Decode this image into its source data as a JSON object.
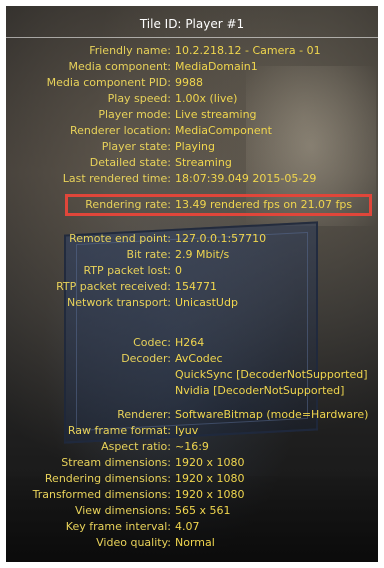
{
  "tile": {
    "title_prefix": "Tile ID:",
    "title_value": "Player #1"
  },
  "section1": [
    {
      "label": "Friendly name:",
      "value": "10.2.218.12 - Camera - 01"
    },
    {
      "label": "Media component:",
      "value": "MediaDomain1"
    },
    {
      "label": "Media component PID:",
      "value": "9988"
    },
    {
      "label": "Play speed:",
      "value": "1.00x (live)"
    },
    {
      "label": "Player mode:",
      "value": "Live streaming"
    },
    {
      "label": "Renderer location:",
      "value": "MediaComponent"
    },
    {
      "label": "Player state:",
      "value": "Playing"
    },
    {
      "label": "Detailed state:",
      "value": "Streaming"
    },
    {
      "label": "Last rendered time:",
      "value": "18:07:39.049 2015-05-29"
    },
    {
      "label": "Rendering rate:",
      "value": "13.49 rendered fps on 21.07 fps"
    }
  ],
  "section2": [
    {
      "label": "Remote end point:",
      "value": "127.0.0.1:57710"
    },
    {
      "label": "Bit rate:",
      "value": "2.9 Mbit/s"
    },
    {
      "label": "RTP packet lost:",
      "value": "0"
    },
    {
      "label": "RTP packet received:",
      "value": "154771"
    },
    {
      "label": "Network transport:",
      "value": "UnicastUdp"
    }
  ],
  "section3": {
    "codec": {
      "label": "Codec:",
      "value": "H264"
    },
    "decoder": {
      "label": "Decoder:",
      "value": "AvCodec",
      "extra1": "QuickSync [DecoderNotSupported]",
      "extra2": "Nvidia [DecoderNotSupported]"
    },
    "renderer": {
      "label": "Renderer:",
      "value": "SoftwareBitmap (mode=Hardware)"
    },
    "rows": [
      {
        "label": "Raw frame format:",
        "value": "Iyuv"
      },
      {
        "label": "Aspect ratio:",
        "value": "~16:9"
      },
      {
        "label": "Stream dimensions:",
        "value": "1920 x 1080"
      },
      {
        "label": "Rendering dimensions:",
        "value": "1920 x 1080"
      },
      {
        "label": "Transformed dimensions:",
        "value": "1920 x 1080"
      },
      {
        "label": "View dimensions:",
        "value": "565 x 561"
      },
      {
        "label": "Key frame interval:",
        "value": "4.07"
      },
      {
        "label": "Video quality:",
        "value": "Normal"
      }
    ]
  },
  "colors": {
    "label": "#e8d25a",
    "value": "#f0d64e",
    "highlight_border": "#e0463a",
    "title": "#ffffff"
  }
}
